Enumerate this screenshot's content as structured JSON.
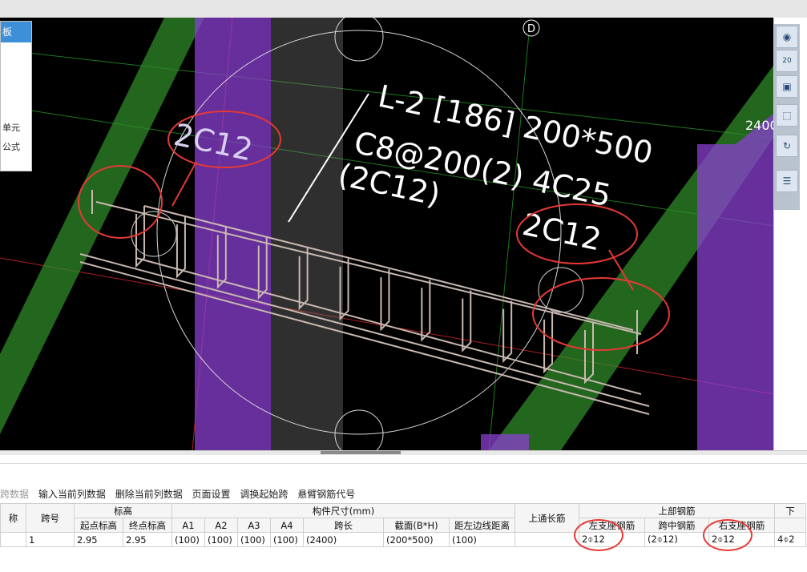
{
  "float_panel": {
    "header": "板",
    "items": [
      "单元",
      "公式"
    ]
  },
  "viewport": {
    "axis_label": "D",
    "beam_annotation": [
      "L-2 [186] 200*500",
      "C8@200(2) 4C25",
      "(2C12)"
    ],
    "callouts": [
      "2C12",
      "2C12"
    ],
    "right_edge_text": "2400"
  },
  "right_toolbar": {
    "icons": [
      "orbit-icon",
      "plan-view-icon",
      "box-view-icon",
      "select-box-icon",
      "rotate-icon",
      "layers-icon"
    ],
    "plan_view_number": "20"
  },
  "grid_toolbar": {
    "items": [
      {
        "label": "跨数据",
        "enabled": false
      },
      {
        "label": "输入当前列数据",
        "enabled": true
      },
      {
        "label": "删除当前列数据",
        "enabled": true
      },
      {
        "label": "页面设置",
        "enabled": true
      },
      {
        "label": "调换起始跨",
        "enabled": true
      },
      {
        "label": "悬臂钢筋代号",
        "enabled": true
      }
    ]
  },
  "grid": {
    "group_headers": {
      "name": "称",
      "span_no": "跨号",
      "elevation": "标高",
      "dimensions": "构件尺寸(mm)",
      "top_through": "上通长筋",
      "top_rebar": "上部钢筋",
      "bottom": "下"
    },
    "sub_headers": {
      "start_elev": "起点标高",
      "end_elev": "终点标高",
      "a1": "A1",
      "a2": "A2",
      "a3": "A3",
      "a4": "A4",
      "span_len": "跨长",
      "section": "截面(B*H)",
      "left_edge_dist": "距左边线距离",
      "left_support": "左支座钢筋",
      "mid_span": "跨中钢筋",
      "right_support": "右支座钢筋"
    },
    "row": {
      "span_no": "1",
      "start_elev": "2.95",
      "end_elev": "2.95",
      "a1": "(100)",
      "a2": "(100)",
      "a3": "(100)",
      "a4": "(100)",
      "span_len": "(2400)",
      "section": "(200*500)",
      "left_edge_dist": "(100)",
      "top_through": "",
      "left_support": "2⌽12",
      "mid_span": "(2⌽12)",
      "right_support": "2⌽12",
      "bottom": "4⌽2"
    }
  },
  "colors": {
    "viewport_bg": "#000000",
    "green_beam": "#2f8a2a",
    "purple_column": "#8a3fd0",
    "rebar": "#c8b8b0",
    "highlight_circle": "#e53935",
    "panel_header": "#3d8fd8"
  }
}
